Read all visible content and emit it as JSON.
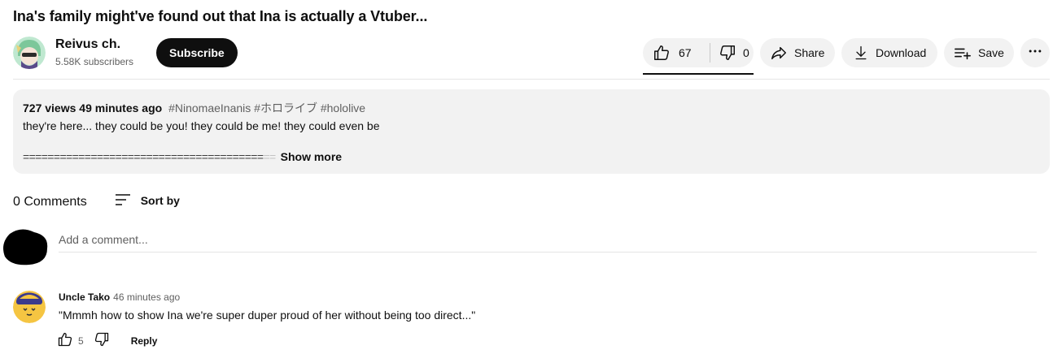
{
  "video": {
    "title": "Ina's family might've found out that Ina is actually a Vtuber...",
    "channel_name": "Reivus ch.",
    "subscribers": "5.58K subscribers",
    "subscribe_label": "Subscribe",
    "like_count": "67",
    "dislike_count": "0",
    "share_label": "Share",
    "download_label": "Download",
    "save_label": "Save"
  },
  "description": {
    "views": "727 views",
    "age": "49 minutes ago",
    "tags": "#NinomaeInanis #ホロライブ #hololive",
    "line1": "they're here... they could be you! they could be me! they could even be",
    "divider_text": "=======================================",
    "divider_fade": "==",
    "show_more": "Show more"
  },
  "comments": {
    "count_label": "0 Comments",
    "sort_label": "Sort by",
    "add_placeholder": "Add a comment...",
    "items": [
      {
        "author": "Uncle Tako",
        "time": "46 minutes ago",
        "text": "\"Mmmh how to show Ina we're super duper proud of her without being too direct...\"",
        "likes": "5",
        "reply_label": "Reply"
      }
    ]
  },
  "colors": {
    "text": "#0f0f0f",
    "secondary": "#606060",
    "pill_bg": "#f2f2f2",
    "subscribe_bg": "#0f0f0f",
    "channel_avatar": "#9ed9b8",
    "commenter_avatar": "#f5c542"
  },
  "icons": [
    "thumb-up-icon",
    "thumb-down-icon",
    "share-icon",
    "download-icon",
    "save-playlist-icon",
    "more-icon",
    "sort-icon"
  ]
}
